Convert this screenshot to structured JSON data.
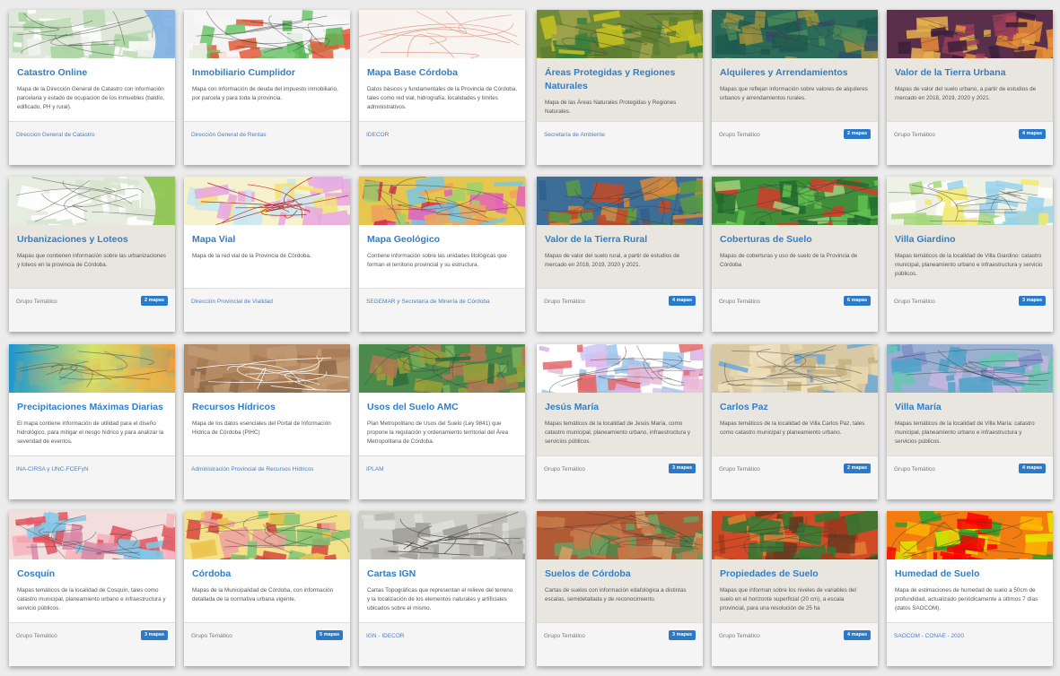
{
  "cards": [
    {
      "title": "Catastro Online",
      "desc": "Mapa de la Dirección General de Catastro con información parcelaria y estado de ocupación de los inmuebles (baldío, edificado, PH y rural).",
      "footer": "Dirección General de Catastro",
      "footer_type": "link",
      "badge": "",
      "theme": "map-parcel-blue"
    },
    {
      "title": "Inmobiliario Cumplidor",
      "desc": "Mapa con información de deuda del impuesto inmobiliario, por parcela y para toda la provincia.",
      "footer": "Dirección General de Rentas",
      "footer_type": "link",
      "badge": "",
      "theme": "map-parcel-green"
    },
    {
      "title": "Mapa Base Córdoba",
      "desc": "Datos básicos y fundamentales de la Provincia de Córdoba, tales como red vial, hidrografía, localidades y límites administrativos.",
      "footer": "IDECOR",
      "footer_type": "link",
      "badge": "",
      "theme": "map-base"
    },
    {
      "title": "Áreas Protegidas y Regiones Naturales",
      "desc": "Mapa de las Áreas Naturales Protegidas y Regiones Naturales.",
      "footer": "Secretaría de Ambiente",
      "footer_type": "link",
      "badge": "",
      "theme": "map-protected"
    },
    {
      "title": "Alquileres y Arrendamientos",
      "desc": "Mapas que reflejan información sobre valores de alquileres urbanos y arrendamientos rurales.",
      "footer": "Grupo Temático",
      "footer_type": "grey",
      "badge": "2 mapas",
      "theme": "map-rent"
    },
    {
      "title": "Valor de la Tierra Urbana",
      "desc": "Mapas de valor del suelo urbano, a partir de estudios de mercado en 2018, 2019, 2020 y 2021.",
      "footer": "Grupo Temático",
      "footer_type": "grey",
      "badge": "4 mapas",
      "theme": "map-urban-value"
    },
    {
      "title": "Urbanizaciones y Loteos",
      "desc": "Mapas que contienen información sobre las urbanizaciones y loteos en la provincia de Córdoba.",
      "footer": "Grupo Temático",
      "footer_type": "grey",
      "badge": "2 mapas",
      "theme": "map-lots"
    },
    {
      "title": "Mapa Vial",
      "desc": "Mapa de la red vial de la Provincia de Córdoba.",
      "footer": "Dirección Provincial de Vialidad",
      "footer_type": "link",
      "badge": "",
      "theme": "map-roads"
    },
    {
      "title": "Mapa Geológico",
      "desc": "Contiene información sobre las unidades litológicas que forman el territorio provincial y su estructura.",
      "footer": "SEGEMAR y Secretaría de Minería de Córdoba",
      "footer_type": "link",
      "badge": "",
      "theme": "map-geo"
    },
    {
      "title": "Valor de la Tierra Rural",
      "desc": "Mapas de valor del suelo rural, a partir de estudios de mercado en 2018, 2019, 2020 y 2021.",
      "footer": "Grupo Temático",
      "footer_type": "grey",
      "badge": "4 mapas",
      "theme": "map-rural-value"
    },
    {
      "title": "Coberturas de Suelo",
      "desc": "Mapas de coberturas y uso de suelo de la Provincia de Córdoba",
      "footer": "Grupo Temático",
      "footer_type": "grey",
      "badge": "6 mapas",
      "theme": "map-cover"
    },
    {
      "title": "Villa Giardino",
      "desc": "Mapas temáticos de la localidad de Villa Giardino: catastro municipal, planeamiento urbano e infraestructura y servicio públicos.",
      "footer": "Grupo Temático",
      "footer_type": "grey",
      "badge": "3 mapas",
      "theme": "map-giardino"
    },
    {
      "title": "Precipitaciones Máximas Diarias",
      "desc": "El mapa contiene información de utilidad para el diseño hidrológico, para mitigar el riesgo hídrico y para analizar la severidad de eventos.",
      "footer": "INA-CIRSA y UNC-FCEFyN",
      "footer_type": "link",
      "badge": "",
      "theme": "map-rain"
    },
    {
      "title": "Recursos Hídricos",
      "desc": "Mapa de los datos esenciales del Portal de Información Hídrica de Córdoba (PIHC)",
      "footer": "Administración Provincial de Recursos Hídricos",
      "footer_type": "link",
      "badge": "",
      "theme": "map-water"
    },
    {
      "title": "Usos del Suelo AMC",
      "desc": "Plan Metropolitano de Usos del Suelo (Ley 9841) que propone la regulación y ordenamiento territorial del Área Metropolitana de Córdoba.",
      "footer": "IPLAM",
      "footer_type": "link",
      "badge": "",
      "theme": "map-amc"
    },
    {
      "title": "Jesús María",
      "desc": "Mapas temáticos de la localidad de Jesús María, como catastro municipal, planeamiento urbano, infraestructura y servicios públicos.",
      "footer": "Grupo Temático",
      "footer_type": "grey",
      "badge": "3 mapas",
      "theme": "map-jesus"
    },
    {
      "title": "Carlos Paz",
      "desc": "Mapas temáticos de la localidad de Villa Carlos Paz, tales como catastro municipal y planeamiento urbano.",
      "footer": "Grupo Temático",
      "footer_type": "grey",
      "badge": "2 mapas",
      "theme": "map-paz"
    },
    {
      "title": "Villa María",
      "desc": "Mapas temáticos de la localidad de Villa María: catastro municipal, planeamiento urbano e infraestructura y servicios públicos.",
      "footer": "Grupo Temático",
      "footer_type": "grey",
      "badge": "4 mapas",
      "theme": "map-vmaria"
    },
    {
      "title": "Cosquín",
      "desc": "Mapas temáticos de la localidad de Cosquín, tales como catastro municipal, planeamiento urbano e infraestructura y servicio públicos.",
      "footer": "Grupo Temático",
      "footer_type": "grey",
      "badge": "3 mapas",
      "theme": "map-cosquin"
    },
    {
      "title": "Córdoba",
      "desc": "Mapas de la Municipalidad de Córdoba, con información detallada de la normativa urbana vigente.",
      "footer": "Grupo Temático",
      "footer_type": "grey",
      "badge": "5 mapas",
      "theme": "map-cordoba"
    },
    {
      "title": "Cartas IGN",
      "desc": "Cartas Topográficas que representan el relieve del terreno y la localización de los elementos naturales y artificiales ubicados sobre el mismo.",
      "footer": "IGN - IDECOR",
      "footer_type": "link",
      "badge": "",
      "theme": "map-ign"
    },
    {
      "title": "Suelos de Córdoba",
      "desc": "Cartas de suelos con información edafológica a distintas escalas, semidetallada y de reconocimiento.",
      "footer": "Grupo Temático",
      "footer_type": "grey",
      "badge": "3 mapas",
      "theme": "map-soils"
    },
    {
      "title": "Propiedades de Suelo",
      "desc": "Mapas que informan sobre los niveles de variables del suelo en el horizonte superficial (20 cm), a escala provincial, para una resolución de 25 ha",
      "footer": "Grupo Temático",
      "footer_type": "grey",
      "badge": "4 mapas",
      "theme": "map-props"
    },
    {
      "title": "Humedad de Suelo",
      "desc": "Mapa de estimaciones de humedad de suelo a 50cm de profundidad, actualizado periódicamente a últimos 7 días (datos SAOCOM).",
      "footer": "SAOCOM - CONAE - 2020",
      "footer_type": "link",
      "badge": "",
      "theme": "map-humidity"
    }
  ],
  "colors": {
    "title": "#2f7ec7",
    "link": "#4a7fc1",
    "badge": "#2a7ac9"
  }
}
